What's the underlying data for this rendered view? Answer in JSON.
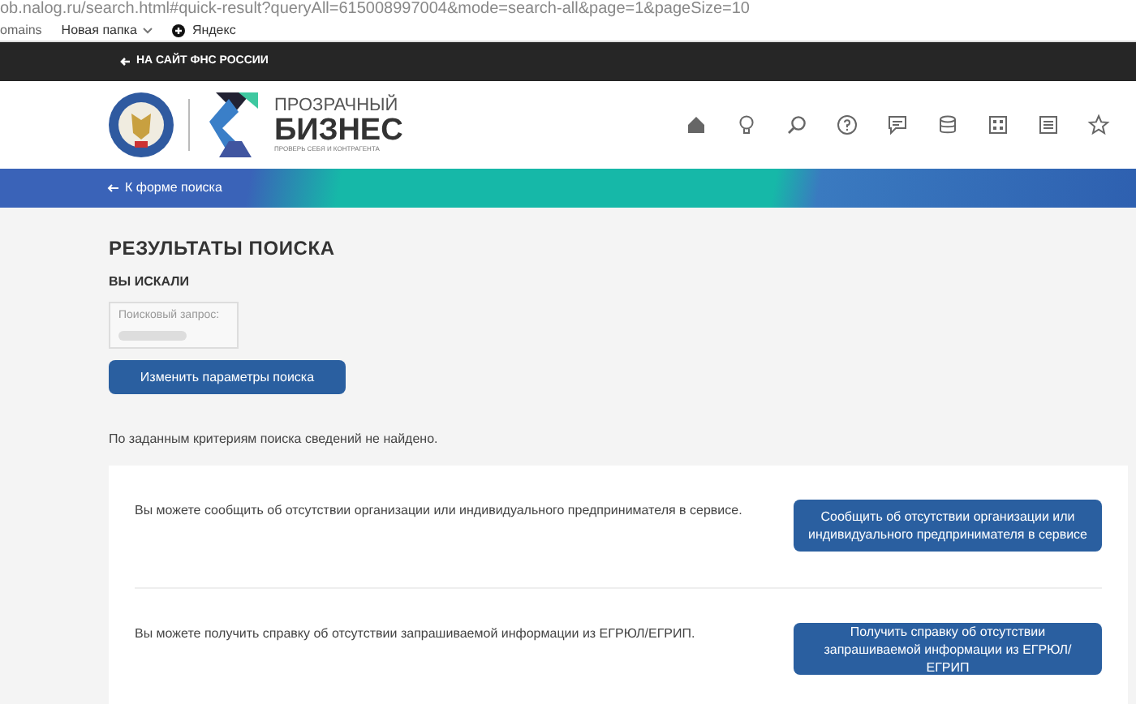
{
  "browser": {
    "url": "ob.nalog.ru/search.html#quick-result?queryAll=615008997004&mode=search-all&page=1&pageSize=10",
    "bookmarks": [
      {
        "label": "omains",
        "kind": "plain"
      },
      {
        "label": "Новая папка",
        "kind": "folder"
      },
      {
        "label": "Яндекс",
        "kind": "site"
      }
    ]
  },
  "top_bar": {
    "link": "НА САЙТ ФНС РОССИИ"
  },
  "header": {
    "brand": {
      "line_1": "ПРОЗРАЧНЫЙ",
      "line_2": "БИЗНЕС",
      "tagline": "ПРОВЕРЬ СЕБЯ И КОНТРАГЕНТА"
    }
  },
  "back_link": "К форме поиска",
  "results": {
    "title": "РЕЗУЛЬТАТЫ ПОИСКА",
    "subtitle": "ВЫ ИСКАЛИ",
    "query_label": "Поисковый запрос:",
    "change_button": "Изменить параметры поиска",
    "message": "По заданным критериям поиска сведений не найдено."
  },
  "actions": [
    {
      "text": "Вы можете сообщить об отсутствии организации или индивидуального предпринимателя в сервисе.",
      "button": "Сообщить об отсутствии организации или индивидуального предпринимателя в сервисе"
    },
    {
      "text": "Вы можете получить справку об отсутствии запрашиваемой информации из ЕГРЮЛ/ЕГРИП.",
      "button": "Получить справку об отсутствии запрашиваемой информации из ЕГРЮЛ/ЕГРИП"
    }
  ]
}
